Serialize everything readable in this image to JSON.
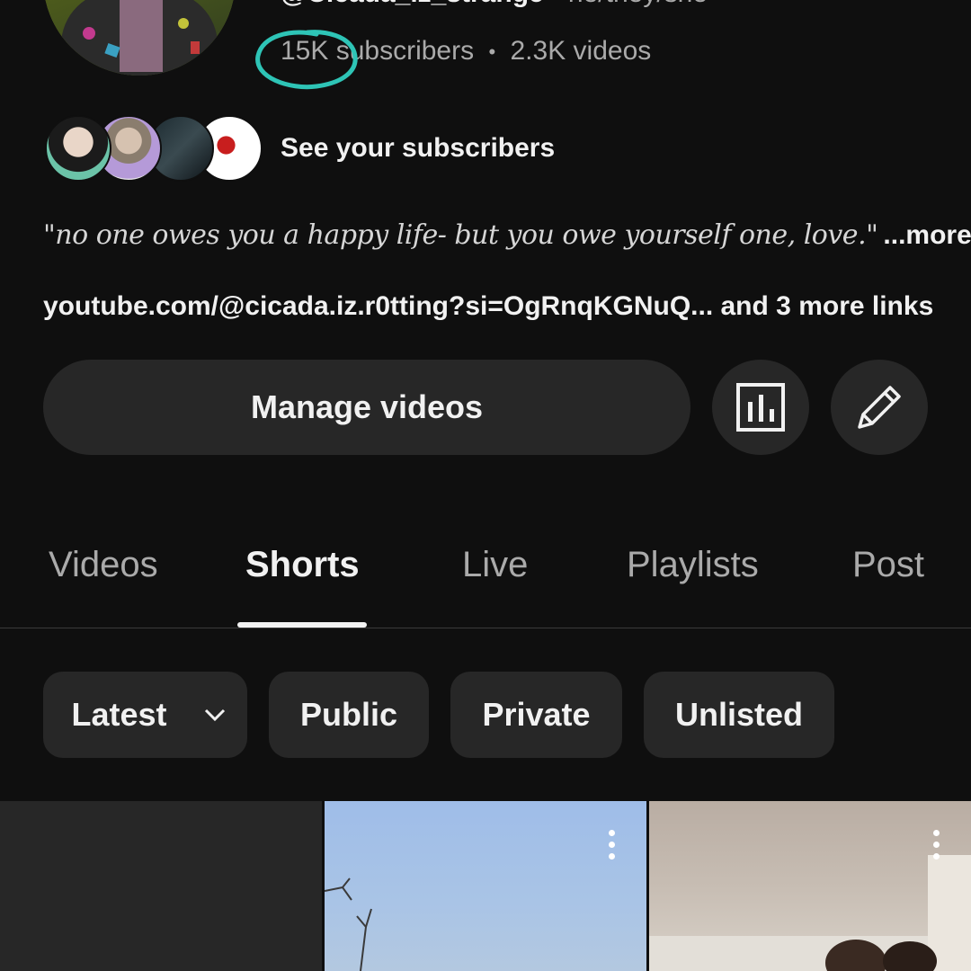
{
  "channel": {
    "handle": "@Cicada_iz_strange",
    "pronouns_sep": "•",
    "pronouns": "he/they/she",
    "subscribers": "15K subscribers",
    "stats_sep": "•",
    "videos": "2.3K videos",
    "see_subscribers": "See your subscribers",
    "bio": "\"no one owes you a happy life- but you owe yourself one, love.\"",
    "bio_more": "...more",
    "links": "youtube.com/@cicada.iz.r0tting?si=OgRnqKGNuQ... and 3 more links"
  },
  "actions": {
    "manage_videos": "Manage videos",
    "analytics_icon": "bar-chart-icon",
    "edit_icon": "pencil-icon"
  },
  "tabs": [
    {
      "label": "Videos"
    },
    {
      "label": "Shorts"
    },
    {
      "label": "Live"
    },
    {
      "label": "Playlists"
    },
    {
      "label": "Post"
    }
  ],
  "active_tab": "Shorts",
  "filters": {
    "sort": "Latest",
    "chips": [
      "Public",
      "Private",
      "Unlisted"
    ]
  },
  "colors": {
    "background": "#0f0f0f",
    "surface": "#272727",
    "text_primary": "#f1f1f1",
    "text_secondary": "#aaaaaa",
    "annotation": "#2ec4b6"
  }
}
